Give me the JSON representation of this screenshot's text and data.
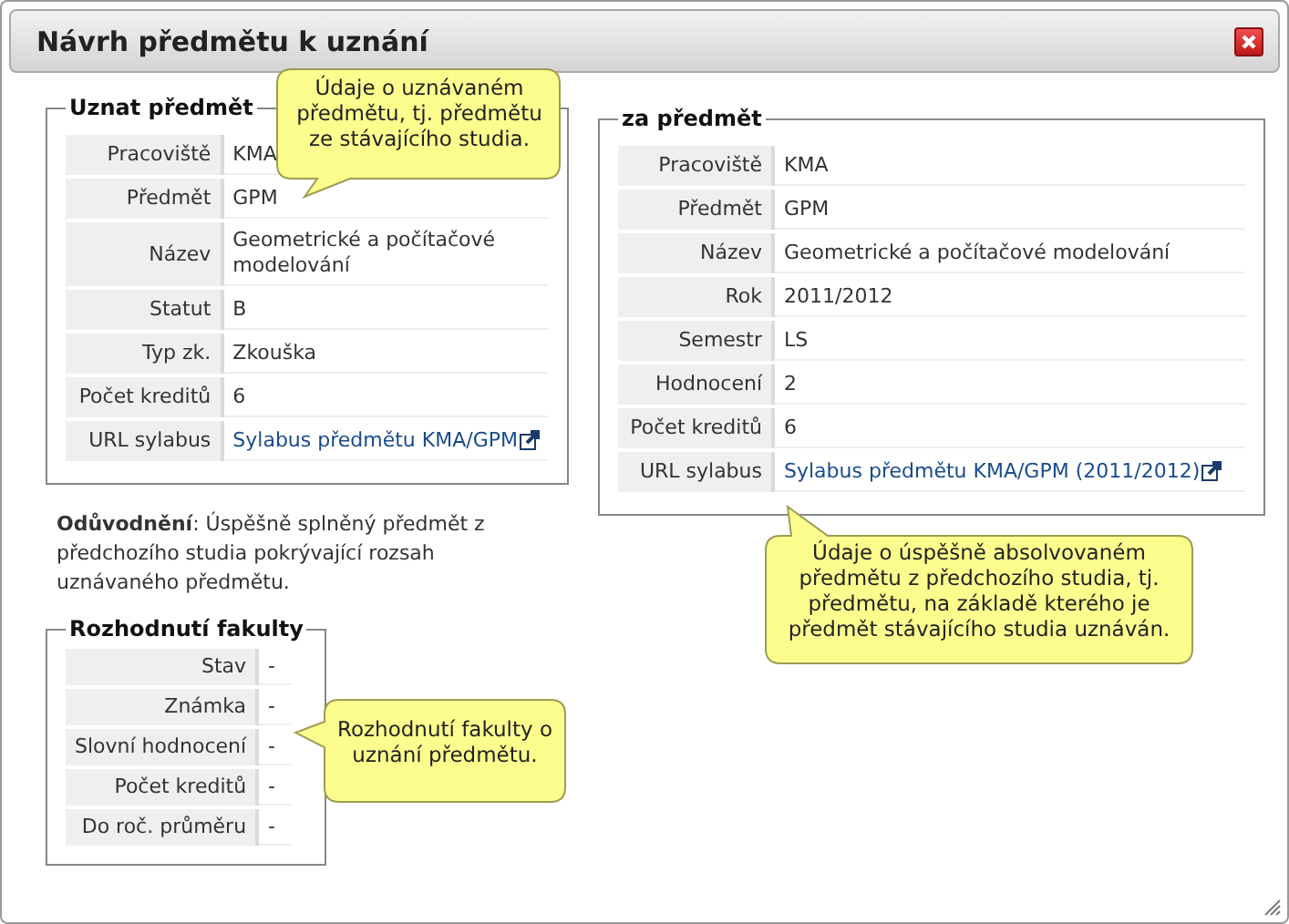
{
  "dialog": {
    "title": "Návrh předmětu k uznání"
  },
  "recognized_course": {
    "legend": "Uznat předmět",
    "rows": [
      {
        "label": "Pracoviště",
        "value": "KMA",
        "kind": "text"
      },
      {
        "label": "Předmět",
        "value": "GPM",
        "kind": "text"
      },
      {
        "label": "Název",
        "value": "Geometrické a počítačové modelování",
        "kind": "text"
      },
      {
        "label": "Statut",
        "value": "B",
        "kind": "text"
      },
      {
        "label": "Typ zk.",
        "value": "Zkouška",
        "kind": "text"
      },
      {
        "label": "Počet kreditů",
        "value": "6",
        "kind": "text"
      },
      {
        "label": "URL sylabus",
        "value": "Sylabus předmětu KMA/GPM",
        "kind": "link"
      }
    ]
  },
  "previous_course": {
    "legend": "za předmět",
    "rows": [
      {
        "label": "Pracoviště",
        "value": "KMA",
        "kind": "text"
      },
      {
        "label": "Předmět",
        "value": "GPM",
        "kind": "text"
      },
      {
        "label": "Název",
        "value": "Geometrické a počítačové modelování",
        "kind": "text"
      },
      {
        "label": "Rok",
        "value": "2011/2012",
        "kind": "text"
      },
      {
        "label": "Semestr",
        "value": "LS",
        "kind": "text"
      },
      {
        "label": "Hodnocení",
        "value": "2",
        "kind": "text"
      },
      {
        "label": "Počet kreditů",
        "value": "6",
        "kind": "text"
      },
      {
        "label": "URL sylabus",
        "value": "Sylabus předmětu KMA/GPM (2011/2012)",
        "kind": "link"
      }
    ]
  },
  "justification": "**Odůvodnění**: Úspěšně splněný předmět z předchozího studia pokrývající rozsah uznávaného předmětu.",
  "faculty_decision": {
    "legend": "Rozhodnutí fakulty",
    "rows": [
      {
        "label": "Stav",
        "value": "-",
        "kind": "text"
      },
      {
        "label": "Známka",
        "value": "-",
        "kind": "text"
      },
      {
        "label": "Slovní hodnocení",
        "value": "-",
        "kind": "text"
      },
      {
        "label": "Počet kreditů",
        "value": "-",
        "kind": "text"
      },
      {
        "label": "Do roč. průměru",
        "value": "-",
        "kind": "text"
      }
    ]
  },
  "tooltips": [
    {
      "text": "Údaje o uznávaném předmětu, tj. předmětu ze stávajícího studia."
    },
    {
      "text": "Údaje o úspěšně absolvovaném předmětu z předchozího studia, tj. předmětu, na základě kterého je předmět stávajícího studia uznáván."
    },
    {
      "text": "Rozhodnutí fakulty o uznání předmětu."
    }
  ]
}
